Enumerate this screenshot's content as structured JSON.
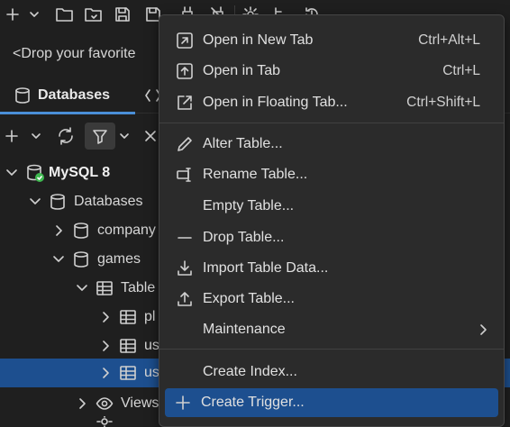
{
  "toolbar": {
    "icons": [
      "add-icon",
      "chevron-down-icon",
      "open-folder-icon",
      "open-folder-alt-icon",
      "save-icon",
      "save-as-icon",
      "connect-icon",
      "disconnect-icon",
      "settings-icon",
      "tree-icon",
      "history-icon"
    ]
  },
  "dropbar": {
    "text": "<Drop your favorite"
  },
  "tabs": {
    "databases_label": "Databases"
  },
  "tree": {
    "root": "MySQL 8",
    "databases": "Databases",
    "company": "company",
    "games": "games",
    "tables": "Table",
    "t1": "pl",
    "t2": "us",
    "t3": "us",
    "views": "Views"
  },
  "menu": {
    "items": [
      {
        "label": "Open in New Tab",
        "shortcut": "Ctrl+Alt+L",
        "icon": "open-new-tab-icon"
      },
      {
        "label": "Open in Tab",
        "shortcut": "Ctrl+L",
        "icon": "open-tab-icon"
      },
      {
        "label": "Open in Floating Tab...",
        "shortcut": "Ctrl+Shift+L",
        "icon": "floating-tab-icon"
      },
      {
        "label": "Alter Table...",
        "icon": "pencil-icon"
      },
      {
        "label": "Rename Table...",
        "icon": "rename-icon"
      },
      {
        "label": "Empty Table...",
        "icon": ""
      },
      {
        "label": "Drop Table...",
        "icon": "minus-icon"
      },
      {
        "label": "Import Table Data...",
        "icon": "import-icon"
      },
      {
        "label": "Export Table...",
        "icon": "export-icon"
      },
      {
        "label": "Maintenance",
        "icon": "",
        "submenu": true
      },
      {
        "label": "Create Index...",
        "icon": ""
      },
      {
        "label": "Create Trigger...",
        "icon": "plus-icon"
      }
    ]
  },
  "colors": {
    "background": "#1f1f1f",
    "menu_bg": "#2b2b2b",
    "selection": "#1d4f8f",
    "accent": "#4a8fd8",
    "status_green": "#3fb950"
  }
}
